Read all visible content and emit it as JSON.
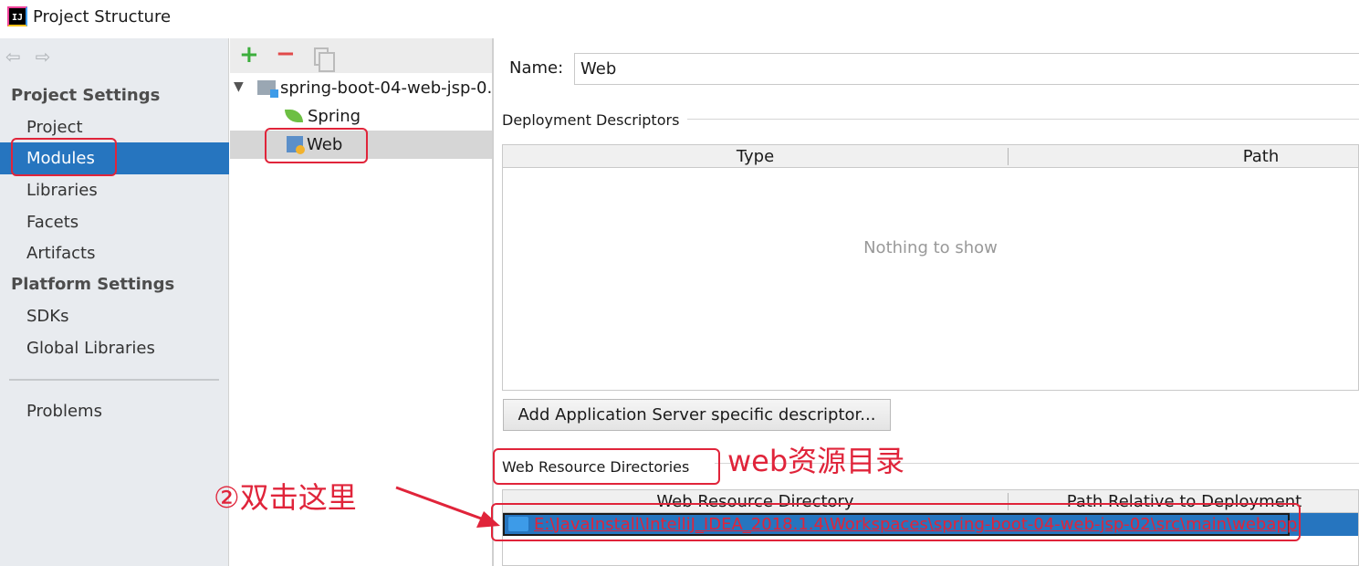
{
  "window": {
    "title": "Project Structure",
    "icon": "intellij-icon"
  },
  "sidebar": {
    "project_settings_label": "Project Settings",
    "project_items": [
      "Project",
      "Modules",
      "Libraries",
      "Facets",
      "Artifacts"
    ],
    "platform_settings_label": "Platform Settings",
    "platform_items": [
      "SDKs",
      "Global Libraries"
    ],
    "problems_label": "Problems",
    "selected": "Modules"
  },
  "tree": {
    "toolbar": {
      "add": "+",
      "remove": "−"
    },
    "root_label": "spring-boot-04-web-jsp-0…",
    "children": [
      "Spring",
      "Web"
    ],
    "selected": "Web"
  },
  "panel": {
    "name_label": "Name:",
    "name_value": "Web",
    "deployment_title": "Deployment Descriptors",
    "deployment_columns": [
      "Type",
      "Path"
    ],
    "empty_text": "Nothing to show",
    "add_button": "Add Application Server specific descriptor...",
    "web_resources_title": "Web Resource Directories",
    "web_resources_columns": [
      "Web Resource Directory",
      "Path Relative to Deployment"
    ],
    "web_resource_row": "E:\\JavaInstall\\IntelliJ_IDEA_2018.1.4\\Workspaces\\spring-boot-04-web-jsp-02\\src\\main\\webapp"
  },
  "annotations": {
    "web_resources_note": "web资源目录",
    "double_click_note": "②双击这里"
  },
  "colors": {
    "selection": "#2675bf",
    "annotation": "#e0243a"
  }
}
